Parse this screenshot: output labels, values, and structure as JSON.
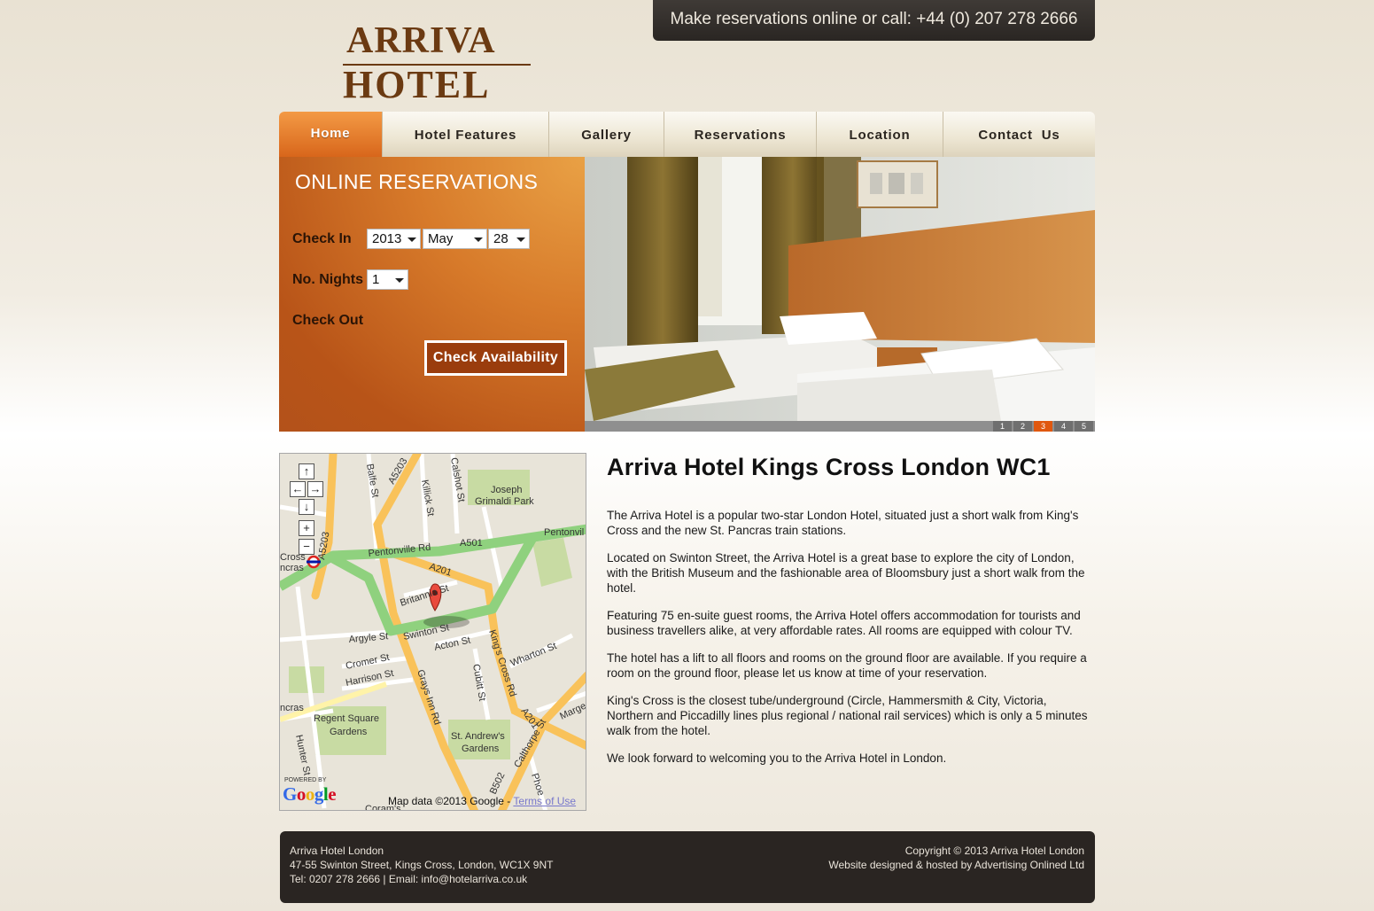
{
  "logo": {
    "line1": "ARRIVA",
    "line2": "HOTEL"
  },
  "callbar": {
    "text": "Make reservations online or call: +44 (0) 207 278 2666"
  },
  "nav": {
    "items": [
      {
        "label": "Home"
      },
      {
        "label": "Hotel Features"
      },
      {
        "label": "Gallery"
      },
      {
        "label": "Reservations"
      },
      {
        "label": "Location"
      },
      {
        "label": "Contact  Us"
      }
    ]
  },
  "reservation": {
    "title": "ONLINE RESERVATIONS",
    "check_in_label": "Check In",
    "year": "2013",
    "month": "May",
    "day": "28",
    "nights_label": "No. Nights",
    "nights": "1",
    "check_out_label": "Check Out",
    "button": "Check Availability"
  },
  "slider": {
    "pages": [
      "1",
      "2",
      "3",
      "4",
      "5"
    ],
    "current": 3
  },
  "map": {
    "labels": {
      "joseph": "Joseph",
      "grimaldi": "Grimaldi Park",
      "pentonville_rd": "Pentonville Rd",
      "a501": "A501",
      "pentonvil": "Pentonvil",
      "a201a": "A201",
      "britannia": "Britannia St",
      "swinton": "Swinton St",
      "argyle": "Argyle St",
      "acton": "Acton St",
      "cromer": "Cromer St",
      "harrison": "Harrison St",
      "wharton": "Wharton St",
      "regent1": "Regent Square",
      "regent2": "Gardens",
      "standrews1": "St. Andrew's",
      "standrews2": "Gardens",
      "grays": "Grays Inn Rd",
      "kingsx": "King's Cross Rd",
      "cubitt": "Cubitt St",
      "a201b": "A201",
      "balfe": "Balfe St",
      "killick": "Killick St",
      "calshot": "Calshot St",
      "a5203a": "A5203",
      "a5203b": "A5203",
      "cross": "Cross",
      "ncras": "ncras",
      "ncras2": "ncras",
      "hunter": "Hunter St",
      "b502": "B502",
      "calthorpe": "Calthorpe St",
      "phoenix": "Phoe",
      "marge": "Marge",
      "coram": "Coram's"
    },
    "powered": "POWERED BY",
    "google": "Google",
    "data_text": "Map data ©2013 Google - ",
    "terms": "Terms of Use"
  },
  "content": {
    "heading": "Arriva Hotel Kings Cross London WC1",
    "paragraphs": [
      "The Arriva Hotel is a popular two-star London Hotel, situated just a short walk from King's Cross and the new St. Pancras train stations.",
      "Located on Swinton Street, the Arriva Hotel is a great base to explore the city of London, with the British Museum and the fashionable area of Bloomsbury just a short walk from the hotel.",
      "Featuring 75 en-suite guest rooms, the Arriva Hotel offers accommodation for tourists and business travellers alike, at very affordable rates. All rooms are equipped with colour TV.",
      "The hotel has a lift to all floors and rooms on the ground floor are available. If you require a room on the ground floor, please let us know at time of your reservation.",
      "King's Cross is the closest tube/underground (Circle, Hammersmith & City, Victoria, Northern and Piccadilly lines plus regional / national rail services) which is only a 5 minutes walk from the hotel.",
      "We look forward to welcoming you to the Arriva Hotel in London."
    ]
  },
  "footer": {
    "left1": "Arriva Hotel London",
    "left2": "47-55 Swinton Street, Kings Cross, London, WC1X 9NT",
    "left3": "Tel: 0207 278 2666 | Email: info@hotelarriva.co.uk",
    "right1": "Copyright © 2013 Arriva Hotel London",
    "right2": "Website designed & hosted by Advertising Onlined Ltd"
  },
  "colors": {
    "accent": "#e0580f",
    "brand_brown": "#6b3a12",
    "footer_bg": "#2a2522"
  }
}
